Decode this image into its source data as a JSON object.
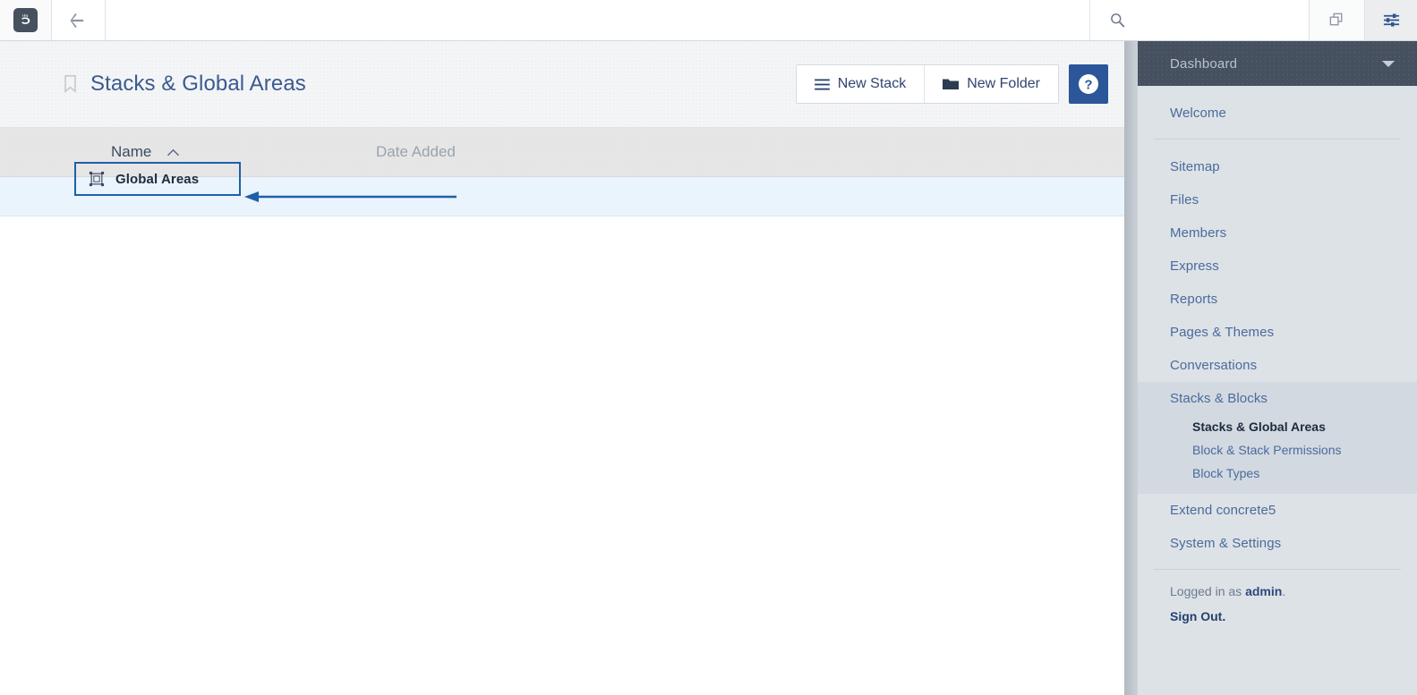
{
  "browser": {
    "logo_name": "concrete5-logo",
    "back_label": "Back",
    "url_value": "",
    "url_placeholder": "",
    "search_placeholder": "",
    "search_value": "",
    "copy_icon": "copy-pages-icon",
    "settings_icon": "sliders-icon"
  },
  "page": {
    "title": "Stacks & Global Areas",
    "bookmark_icon": "bookmark-icon",
    "actions": {
      "new_stack": "New Stack",
      "new_folder": "New Folder",
      "help": "?"
    }
  },
  "table": {
    "columns": [
      "Name",
      "Date Added"
    ],
    "sort_column": "Name",
    "sort_direction": "asc",
    "rows": [
      {
        "name": "Global Areas",
        "icon": "global-area-icon",
        "date_added": ""
      }
    ]
  },
  "annotation": {
    "highlight_target": "Global Areas",
    "arrow_color": "#1f5fa9",
    "box_color": "#1f5fa9"
  },
  "sidebar": {
    "header": {
      "title": "Dashboard",
      "chevron_icon": "chevron-down-icon"
    },
    "groups": [
      {
        "items": [
          {
            "label": "Welcome"
          }
        ]
      },
      {
        "items": [
          {
            "label": "Sitemap"
          },
          {
            "label": "Files"
          },
          {
            "label": "Members"
          },
          {
            "label": "Express"
          },
          {
            "label": "Reports"
          },
          {
            "label": "Pages & Themes"
          },
          {
            "label": "Conversations"
          },
          {
            "label": "Stacks & Blocks",
            "expanded": true,
            "children": [
              {
                "label": "Stacks & Global Areas",
                "active": true
              },
              {
                "label": "Block & Stack Permissions",
                "active": false
              },
              {
                "label": "Block Types",
                "active": false
              }
            ]
          },
          {
            "label": "Extend concrete5"
          },
          {
            "label": "System & Settings"
          }
        ]
      }
    ],
    "footer": {
      "logged_in_prefix": "Logged in as ",
      "username": "admin",
      "logged_in_suffix": ".",
      "sign_out": "Sign Out."
    }
  },
  "colors": {
    "accent": "#2b5699",
    "sidebar_bg": "#dde2e7",
    "sidebar_header_bg": "#46505e",
    "row_highlight": "#eaf4fc",
    "title_color": "#3b5a92"
  }
}
